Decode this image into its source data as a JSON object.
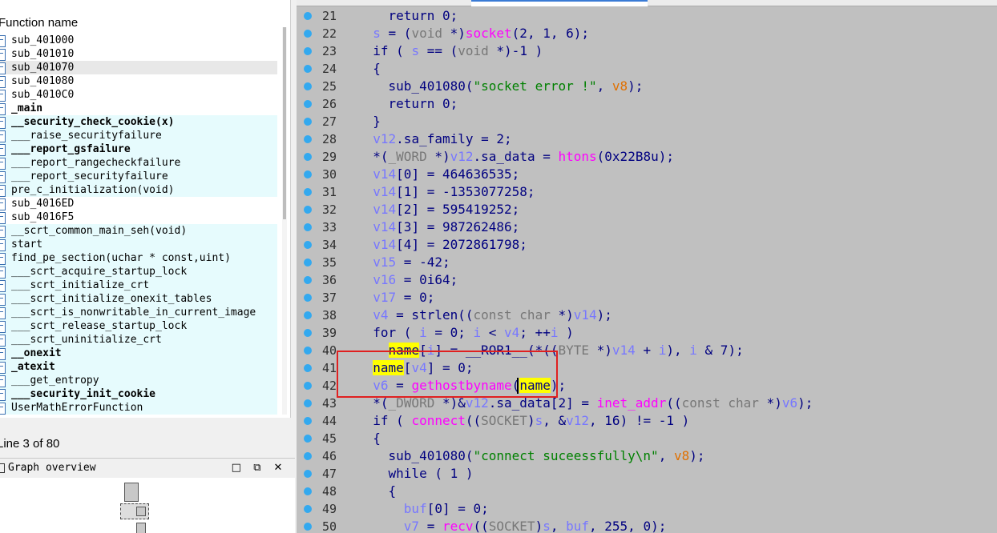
{
  "function_panel": {
    "header": "Function name",
    "functions": [
      {
        "name": "sub_401000",
        "bold": false,
        "lib": false,
        "selected": false
      },
      {
        "name": "sub_401010",
        "bold": false,
        "lib": false,
        "selected": false
      },
      {
        "name": "sub_401070",
        "bold": false,
        "lib": false,
        "selected": true
      },
      {
        "name": "sub_401080",
        "bold": false,
        "lib": false,
        "selected": false
      },
      {
        "name": "sub_4010C0",
        "bold": false,
        "lib": false,
        "selected": false
      },
      {
        "name": "_main",
        "bold": true,
        "lib": false,
        "selected": false
      },
      {
        "name": "__security_check_cookie(x)",
        "bold": true,
        "lib": true,
        "selected": false
      },
      {
        "name": "___raise_securityfailure",
        "bold": false,
        "lib": true,
        "selected": false
      },
      {
        "name": "___report_gsfailure",
        "bold": true,
        "lib": true,
        "selected": false
      },
      {
        "name": "___report_rangecheckfailure",
        "bold": false,
        "lib": true,
        "selected": false
      },
      {
        "name": "___report_securityfailure",
        "bold": false,
        "lib": true,
        "selected": false
      },
      {
        "name": "pre_c_initialization(void)",
        "bold": false,
        "lib": true,
        "selected": false
      },
      {
        "name": "sub_4016ED",
        "bold": false,
        "lib": false,
        "selected": false
      },
      {
        "name": "sub_4016F5",
        "bold": false,
        "lib": false,
        "selected": false
      },
      {
        "name": "__scrt_common_main_seh(void)",
        "bold": false,
        "lib": true,
        "selected": false
      },
      {
        "name": "start",
        "bold": false,
        "lib": true,
        "selected": false
      },
      {
        "name": "find_pe_section(uchar * const,uint)",
        "bold": false,
        "lib": true,
        "selected": false
      },
      {
        "name": "___scrt_acquire_startup_lock",
        "bold": false,
        "lib": true,
        "selected": false
      },
      {
        "name": "___scrt_initialize_crt",
        "bold": false,
        "lib": true,
        "selected": false
      },
      {
        "name": "___scrt_initialize_onexit_tables",
        "bold": false,
        "lib": true,
        "selected": false
      },
      {
        "name": "___scrt_is_nonwritable_in_current_image",
        "bold": false,
        "lib": true,
        "selected": false
      },
      {
        "name": "___scrt_release_startup_lock",
        "bold": false,
        "lib": true,
        "selected": false
      },
      {
        "name": "___scrt_uninitialize_crt",
        "bold": false,
        "lib": true,
        "selected": false
      },
      {
        "name": "__onexit",
        "bold": true,
        "lib": true,
        "selected": false
      },
      {
        "name": "_atexit",
        "bold": true,
        "lib": true,
        "selected": false
      },
      {
        "name": "___get_entropy",
        "bold": false,
        "lib": true,
        "selected": false
      },
      {
        "name": "___security_init_cookie",
        "bold": true,
        "lib": true,
        "selected": false
      },
      {
        "name": "UserMathErrorFunction",
        "bold": false,
        "lib": true,
        "selected": false
      }
    ],
    "status": "Line 3 of 80"
  },
  "graph_overview": {
    "title": "Graph overview",
    "buttons": [
      "□",
      "⧉",
      "✕"
    ]
  },
  "code": {
    "lines": [
      {
        "n": "21",
        "tokens": [
          [
            "op",
            "    return 0;"
          ]
        ]
      },
      {
        "n": "22",
        "tokens": [
          [
            "op",
            "  "
          ],
          [
            "var",
            "s"
          ],
          [
            "op",
            " = ("
          ],
          [
            "typ",
            "void"
          ],
          [
            "op",
            " *)"
          ],
          [
            "fn",
            "socket"
          ],
          [
            "op",
            "(2, 1, 6);"
          ]
        ]
      },
      {
        "n": "23",
        "tokens": [
          [
            "op",
            "  if ( "
          ],
          [
            "var",
            "s"
          ],
          [
            "op",
            " == ("
          ],
          [
            "typ",
            "void"
          ],
          [
            "op",
            " *)-1 )"
          ]
        ]
      },
      {
        "n": "24",
        "tokens": [
          [
            "op",
            "  {"
          ]
        ]
      },
      {
        "n": "25",
        "tokens": [
          [
            "op",
            "    sub_401080("
          ],
          [
            "str",
            "\"socket error !\""
          ],
          [
            "op",
            ", "
          ],
          [
            "org",
            "v8"
          ],
          [
            "op",
            ");"
          ]
        ]
      },
      {
        "n": "26",
        "tokens": [
          [
            "op",
            "    return 0;"
          ]
        ]
      },
      {
        "n": "27",
        "tokens": [
          [
            "op",
            "  }"
          ]
        ]
      },
      {
        "n": "28",
        "tokens": [
          [
            "op",
            "  "
          ],
          [
            "var",
            "v12"
          ],
          [
            "op",
            ".sa_family = 2;"
          ]
        ]
      },
      {
        "n": "29",
        "tokens": [
          [
            "op",
            "  *("
          ],
          [
            "dim",
            "_WORD"
          ],
          [
            "op",
            " *)"
          ],
          [
            "var",
            "v12"
          ],
          [
            "op",
            ".sa_data = "
          ],
          [
            "fn",
            "htons"
          ],
          [
            "op",
            "(0x22B8u);"
          ]
        ]
      },
      {
        "n": "30",
        "tokens": [
          [
            "op",
            "  "
          ],
          [
            "var",
            "v14"
          ],
          [
            "op",
            "[0] = 464636535;"
          ]
        ]
      },
      {
        "n": "31",
        "tokens": [
          [
            "op",
            "  "
          ],
          [
            "var",
            "v14"
          ],
          [
            "op",
            "[1] = -1353077258;"
          ]
        ]
      },
      {
        "n": "32",
        "tokens": [
          [
            "op",
            "  "
          ],
          [
            "var",
            "v14"
          ],
          [
            "op",
            "[2] = 595419252;"
          ]
        ]
      },
      {
        "n": "33",
        "tokens": [
          [
            "op",
            "  "
          ],
          [
            "var",
            "v14"
          ],
          [
            "op",
            "[3] = 987262486;"
          ]
        ]
      },
      {
        "n": "34",
        "tokens": [
          [
            "op",
            "  "
          ],
          [
            "var",
            "v14"
          ],
          [
            "op",
            "[4] = 2072861798;"
          ]
        ]
      },
      {
        "n": "35",
        "tokens": [
          [
            "op",
            "  "
          ],
          [
            "var",
            "v15"
          ],
          [
            "op",
            " = -42;"
          ]
        ]
      },
      {
        "n": "36",
        "tokens": [
          [
            "op",
            "  "
          ],
          [
            "var",
            "v16"
          ],
          [
            "op",
            " = 0i64;"
          ]
        ]
      },
      {
        "n": "37",
        "tokens": [
          [
            "op",
            "  "
          ],
          [
            "var",
            "v17"
          ],
          [
            "op",
            " = 0;"
          ]
        ]
      },
      {
        "n": "38",
        "tokens": [
          [
            "op",
            "  "
          ],
          [
            "var",
            "v4"
          ],
          [
            "op",
            " = strlen(("
          ],
          [
            "typ",
            "const char"
          ],
          [
            "op",
            " *)"
          ],
          [
            "var",
            "v14"
          ],
          [
            "op",
            ");"
          ]
        ]
      },
      {
        "n": "39",
        "tokens": [
          [
            "op",
            "  for ( "
          ],
          [
            "var",
            "i"
          ],
          [
            "op",
            " = 0; "
          ],
          [
            "var",
            "i"
          ],
          [
            "op",
            " < "
          ],
          [
            "var",
            "v4"
          ],
          [
            "op",
            "; ++"
          ],
          [
            "var",
            "i"
          ],
          [
            "op",
            " )"
          ]
        ]
      },
      {
        "n": "40",
        "tokens": [
          [
            "op",
            "    "
          ],
          [
            "hl",
            "name"
          ],
          [
            "op",
            "["
          ],
          [
            "var",
            "i"
          ],
          [
            "op",
            "] = __ROR1__(*(("
          ],
          [
            "dim",
            "BYTE"
          ],
          [
            "op",
            " *)"
          ],
          [
            "var",
            "v14"
          ],
          [
            "op",
            " + "
          ],
          [
            "var",
            "i"
          ],
          [
            "op",
            "), "
          ],
          [
            "var",
            "i"
          ],
          [
            "op",
            " & 7);"
          ]
        ]
      },
      {
        "n": "41",
        "tokens": [
          [
            "op",
            "  "
          ],
          [
            "hl",
            "name"
          ],
          [
            "op",
            "["
          ],
          [
            "var",
            "v4"
          ],
          [
            "op",
            "] = 0;"
          ]
        ]
      },
      {
        "n": "42",
        "tokens": [
          [
            "op",
            "  "
          ],
          [
            "var",
            "v6"
          ],
          [
            "op",
            " = "
          ],
          [
            "fn",
            "gethostbyname"
          ],
          [
            "op",
            "("
          ],
          [
            "hl",
            "name"
          ],
          [
            "op",
            ");"
          ]
        ]
      },
      {
        "n": "43",
        "tokens": [
          [
            "op",
            "  *("
          ],
          [
            "dim",
            "_DWORD"
          ],
          [
            "op",
            " *)&"
          ],
          [
            "var",
            "v12"
          ],
          [
            "op",
            ".sa_data[2] = "
          ],
          [
            "fn",
            "inet_addr"
          ],
          [
            "op",
            "(("
          ],
          [
            "typ",
            "const char"
          ],
          [
            "op",
            " *)"
          ],
          [
            "var",
            "v6"
          ],
          [
            "op",
            ");"
          ]
        ]
      },
      {
        "n": "44",
        "tokens": [
          [
            "op",
            "  if ( "
          ],
          [
            "fn",
            "connect"
          ],
          [
            "op",
            "(("
          ],
          [
            "dim",
            "SOCKET"
          ],
          [
            "op",
            ")"
          ],
          [
            "var",
            "s"
          ],
          [
            "op",
            ", &"
          ],
          [
            "var",
            "v12"
          ],
          [
            "op",
            ", 16) != -1 )"
          ]
        ]
      },
      {
        "n": "45",
        "tokens": [
          [
            "op",
            "  {"
          ]
        ]
      },
      {
        "n": "46",
        "tokens": [
          [
            "op",
            "    sub_401080("
          ],
          [
            "str",
            "\"connect suceessfully\\n\""
          ],
          [
            "op",
            ", "
          ],
          [
            "org",
            "v8"
          ],
          [
            "op",
            ");"
          ]
        ]
      },
      {
        "n": "47",
        "tokens": [
          [
            "op",
            "    while ( 1 )"
          ]
        ]
      },
      {
        "n": "48",
        "tokens": [
          [
            "op",
            "    {"
          ]
        ]
      },
      {
        "n": "49",
        "tokens": [
          [
            "op",
            "      "
          ],
          [
            "var",
            "buf"
          ],
          [
            "op",
            "[0] = 0;"
          ]
        ]
      },
      {
        "n": "50",
        "tokens": [
          [
            "op",
            "      "
          ],
          [
            "var",
            "v7"
          ],
          [
            "op",
            " = "
          ],
          [
            "fn",
            "recv"
          ],
          [
            "op",
            "(("
          ],
          [
            "dim",
            "SOCKET"
          ],
          [
            "op",
            ")"
          ],
          [
            "var",
            "s"
          ],
          [
            "op",
            ", "
          ],
          [
            "var",
            "buf"
          ],
          [
            "op",
            ", 255, 0);"
          ]
        ]
      }
    ]
  }
}
